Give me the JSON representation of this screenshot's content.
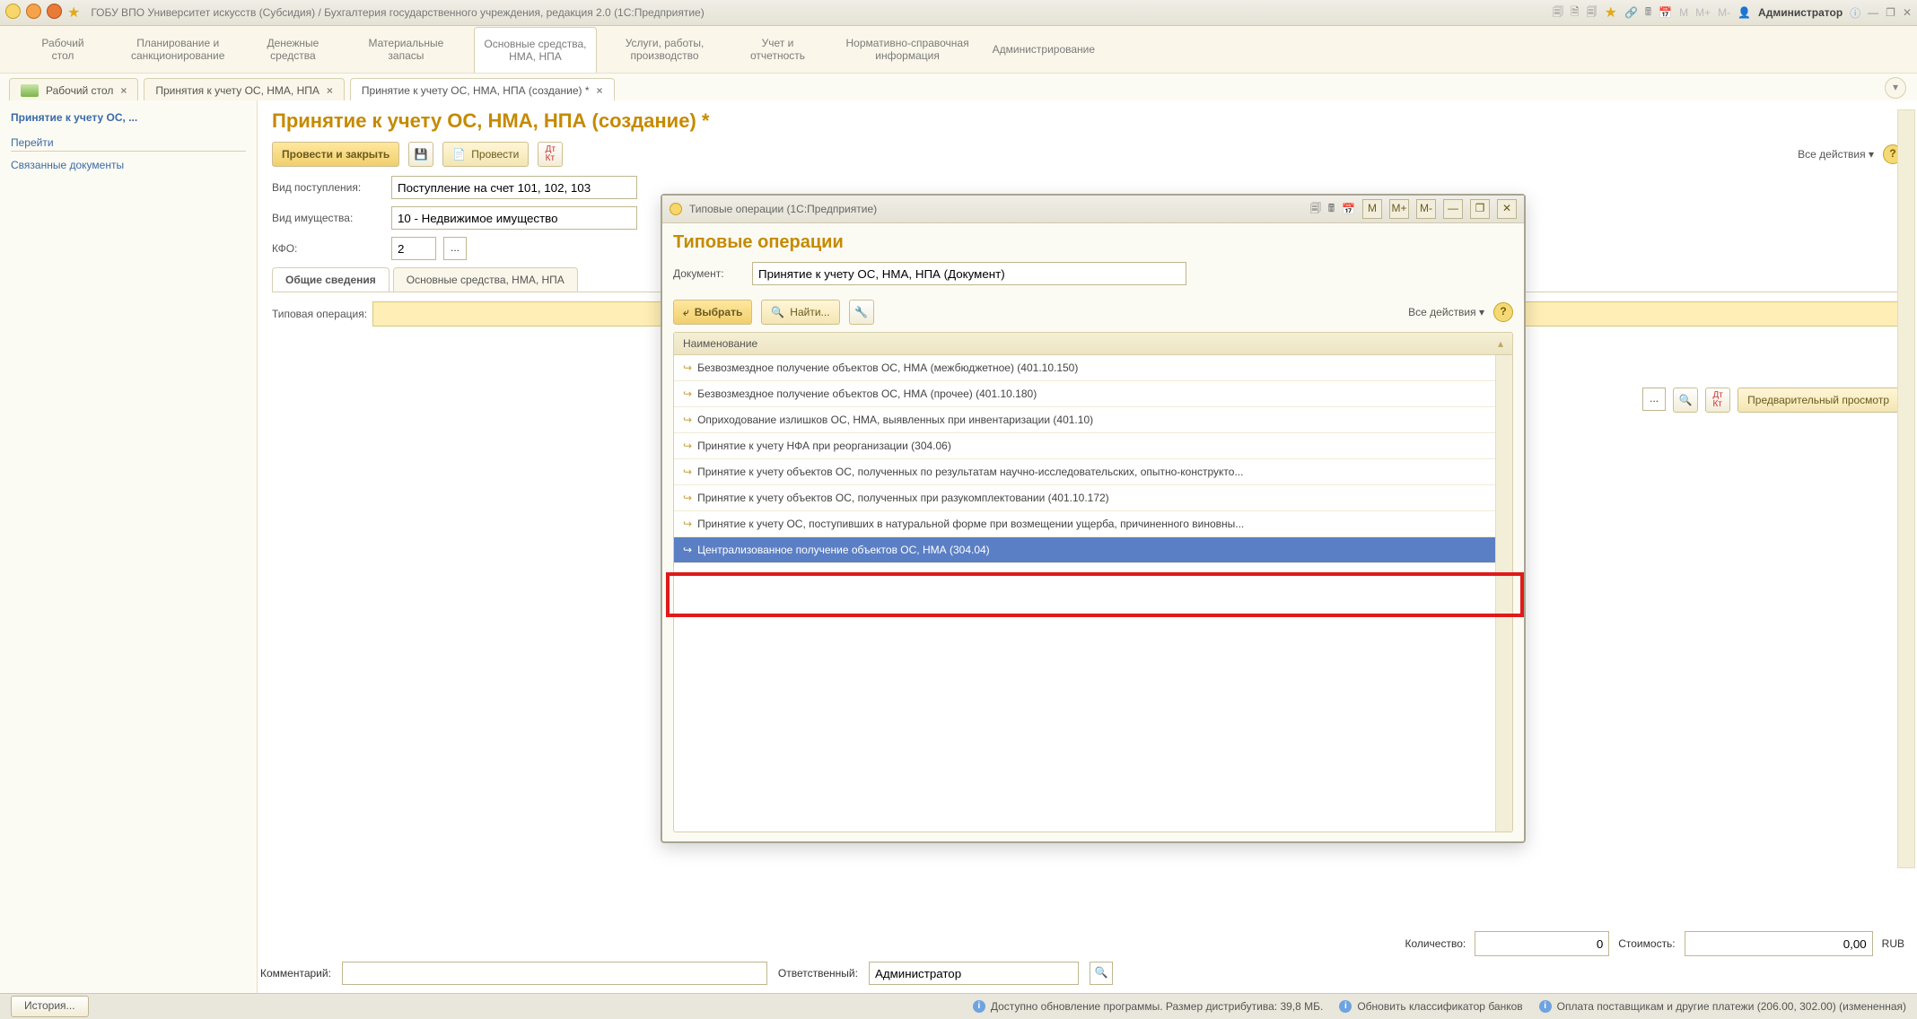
{
  "sysbar": {
    "title": "ГОБУ ВПО Университет искусств (Субсидия) / Бухгалтерия государственного учреждения, редакция 2.0  (1С:Предприятие)",
    "admin": "Администратор",
    "m_labels": [
      "M",
      "M+",
      "M-"
    ]
  },
  "mainnav": {
    "items": [
      "Рабочий\nстол",
      "Планирование и\nсанкционирование",
      "Денежные\nсредства",
      "Материальные\nзапасы",
      "Основные средства,\nНМА, НПА",
      "Услуги, работы,\nпроизводство",
      "Учет и\nотчетность",
      "Нормативно-справочная\nинформация",
      "Администрирование"
    ],
    "active_index": 4
  },
  "tabs": {
    "items": [
      {
        "label": "Рабочий стол"
      },
      {
        "label": "Принятия к учету ОС, НМА, НПА"
      },
      {
        "label": "Принятие к учету ОС, НМА, НПА (создание) *"
      }
    ],
    "active_index": 2
  },
  "sidebar": {
    "title": "Принятие к учету ОС, ...",
    "section_header": "Перейти",
    "links": [
      "Связанные документы"
    ]
  },
  "page": {
    "heading": "Принятие к учету ОС, НМА, НПА (создание) *",
    "toolbar": {
      "conduct_close": "Провести и закрыть",
      "conduct": "Провести",
      "dtkt": "Дт\nКт",
      "all_actions": "Все действия ▾",
      "preview": "Предварительный просмотр"
    },
    "fields": {
      "receipt_kind_label": "Вид поступления:",
      "receipt_kind_value": "Поступление на счет 101, 102, 103",
      "property_kind_label": "Вид имущества:",
      "property_kind_value": "10 - Недвижимое имущество",
      "kfo_label": "КФО:",
      "kfo_value": "2"
    },
    "inner_tabs": [
      "Общие сведения",
      "Основные средства, НМА, НПА"
    ],
    "typical_op_label": "Типовая операция:",
    "typical_op_value": "",
    "totals": {
      "qty_label": "Количество:",
      "qty_value": "0",
      "cost_label": "Стоимость:",
      "cost_value": "0,00",
      "currency": "RUB"
    },
    "bottom": {
      "comment_label": "Комментарий:",
      "responsible_label": "Ответственный:",
      "responsible_value": "Администратор"
    }
  },
  "modal": {
    "window_title": "Типовые операции  (1С:Предприятие)",
    "heading": "Типовые операции",
    "doc_label": "Документ:",
    "doc_value": "Принятие к учету ОС, НМА, НПА (Документ)",
    "toolbar": {
      "select": "Выбрать",
      "find": "Найти...",
      "all_actions": "Все действия ▾"
    },
    "list_header": "Наименование",
    "rows": [
      "Безвозмездное получение объектов ОС, НМА (межбюджетное) (401.10.150)",
      "Безвозмездное получение объектов ОС, НМА (прочее) (401.10.180)",
      "Оприходование излишков ОС, НМА, выявленных при инвентаризации (401.10)",
      "Принятие к учету НФА при реорганизации (304.06)",
      "Принятие к учету объектов ОС, полученных по результатам научно-исследовательских, опытно-конструкто...",
      "Принятие к учету объектов ОС, полученных при разукомплектовании (401.10.172)",
      "Принятие к учету ОС, поступивших в натуральной форме при возмещении ущерба, причиненного виновны...",
      "Централизованное получение объектов ОС, НМА (304.04)"
    ],
    "selected_index": 7,
    "titlebar_m": [
      "M",
      "M+",
      "M-"
    ]
  },
  "statusbar": {
    "history": "История...",
    "update": "Доступно обновление программы. Размер дистрибутива: 39,8 МБ.",
    "banks": "Обновить классификатор банков",
    "payments": "Оплата поставщикам и другие платежи (206.00, 302.00) (измененная)"
  }
}
